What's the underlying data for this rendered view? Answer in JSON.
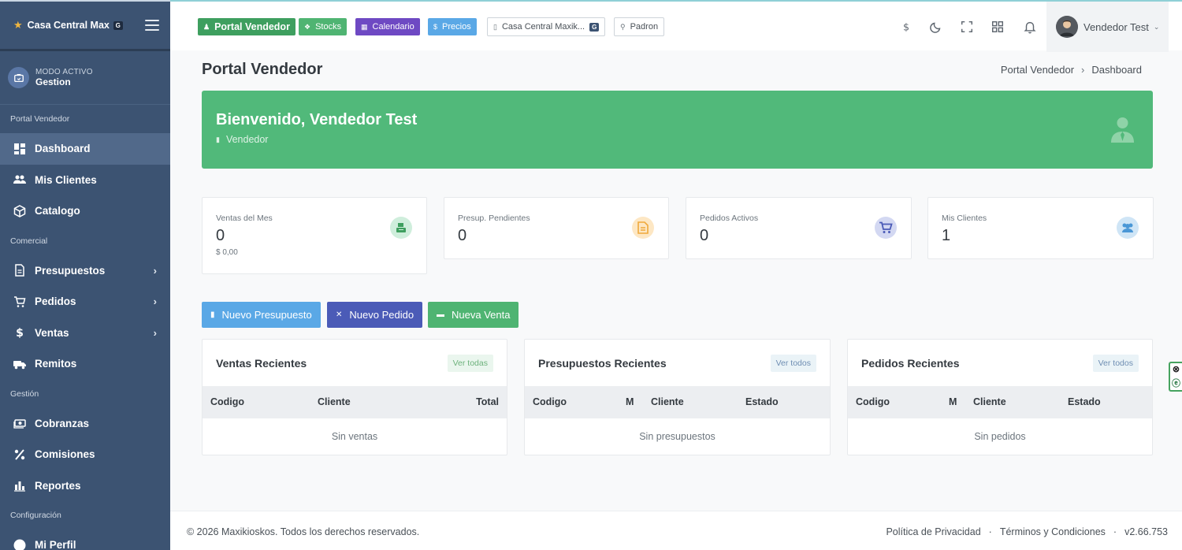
{
  "sidebar": {
    "brand": "Casa Central Maxik...",
    "brand_badge": "G",
    "mode_label": "MODO ACTIVO",
    "mode_value": "Gestion",
    "sections": {
      "portal": "Portal Vendedor",
      "comercial": "Comercial",
      "gestion": "Gestión",
      "config": "Configuración"
    },
    "items": {
      "dashboard": "Dashboard",
      "clientes": "Mis Clientes",
      "catalogo": "Catalogo",
      "presupuestos": "Presupuestos",
      "pedidos": "Pedidos",
      "ventas": "Ventas",
      "remitos": "Remitos",
      "cobranzas": "Cobranzas",
      "comisiones": "Comisiones",
      "reportes": "Reportes",
      "perfil": "Mi Perfil"
    }
  },
  "topbar": {
    "portal": "Portal Vendedor",
    "stocks": "Stocks",
    "calendario": "Calendario",
    "precios": "Precios",
    "store": "Casa Central Maxik...",
    "store_badge": "G",
    "padron": "Padron",
    "user": "Vendedor Test"
  },
  "page": {
    "title": "Portal Vendedor",
    "breadcrumb": [
      "Portal Vendedor",
      "Dashboard"
    ]
  },
  "hero": {
    "title": "Bienvenido, Vendedor Test",
    "role": "Vendedor"
  },
  "stats": [
    {
      "label": "Ventas del Mes",
      "value": "0",
      "sub": "$ 0,00"
    },
    {
      "label": "Presup. Pendientes",
      "value": "0"
    },
    {
      "label": "Pedidos Activos",
      "value": "0"
    },
    {
      "label": "Mis Clientes",
      "value": "1"
    }
  ],
  "actions": {
    "presupuesto": "Nuevo Presupuesto",
    "pedido": "Nuevo Pedido",
    "venta": "Nueva Venta"
  },
  "cards": {
    "ventas": {
      "title": "Ventas Recientes",
      "link": "Ver todas",
      "columns": [
        "Codigo",
        "Cliente",
        "Total"
      ],
      "empty": "Sin ventas"
    },
    "presupuestos": {
      "title": "Presupuestos Recientes",
      "link": "Ver todos",
      "columns": [
        "Codigo",
        "M",
        "Cliente",
        "Estado"
      ],
      "empty": "Sin presupuestos"
    },
    "pedidos": {
      "title": "Pedidos Recientes",
      "link": "Ver todos",
      "columns": [
        "Codigo",
        "M",
        "Cliente",
        "Estado"
      ],
      "empty": "Sin pedidos"
    }
  },
  "footer": {
    "copyright": "© 2026 Maxikioskos. Todos los derechos reservados.",
    "privacy": "Política de Privacidad",
    "terms": "Términos y Condiciones",
    "dot": "·",
    "version": "v2.66.753"
  },
  "colors": {
    "sidebar": "#3c5372",
    "hero": "#51b97a",
    "info": "#5aa8e6",
    "primary": "#4b5bb7",
    "success": "#4fb472"
  }
}
